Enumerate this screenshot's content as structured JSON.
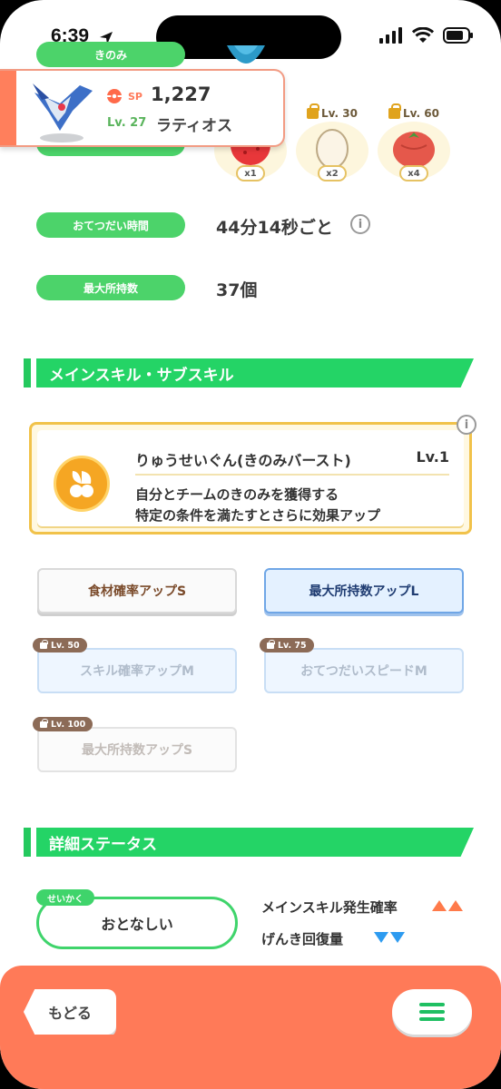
{
  "status_bar": {
    "time": "6:39"
  },
  "pokemon": {
    "sp_label": "SP",
    "sp_value": "1,227",
    "level": "Lv. 27",
    "name": "ラティオス"
  },
  "ingredients": {
    "label": "きのみ",
    "slots": [
      {
        "qty": "x1",
        "lock": ""
      },
      {
        "qty": "x2",
        "lock": "Lv. 30"
      },
      {
        "qty": "x4",
        "lock": "Lv. 60"
      }
    ]
  },
  "stats": {
    "help_time_label": "おてつだい時間",
    "help_time_value": "44分14秒ごと",
    "max_carry_label": "最大所持数",
    "max_carry_value": "37個"
  },
  "main_skill_section": {
    "title": "メインスキル・サブスキル",
    "skill_name": "りゅうせいぐん(きのみバースト)",
    "skill_level": "Lv.1",
    "desc_line1": "自分とチームのきのみを獲得する",
    "desc_line2": "特定の条件を満たすとさらに効果アップ"
  },
  "sub_skills": [
    {
      "label": "食材確率アップS",
      "lock": ""
    },
    {
      "label": "最大所持数アップL",
      "lock": ""
    },
    {
      "label": "スキル確率アップM",
      "lock": "Lv. 50"
    },
    {
      "label": "おてつだいスピードM",
      "lock": "Lv. 75"
    },
    {
      "label": "最大所持数アップS",
      "lock": "Lv. 100"
    }
  ],
  "detail_section": {
    "title": "詳細ステータス",
    "nature_tag": "せいかく",
    "nature_value": "おとなしい",
    "up_label": "メインスキル発生確率",
    "down_label": "げんき回復量"
  },
  "bottom_bar": {
    "back_label": "もどる"
  },
  "colors": {
    "green_accent": "#24d466",
    "orange_bar": "#ff7a58",
    "skill_border": "#f1c24a",
    "up_arrow": "#ff7a4a",
    "down_arrow": "#2d9bf0"
  }
}
